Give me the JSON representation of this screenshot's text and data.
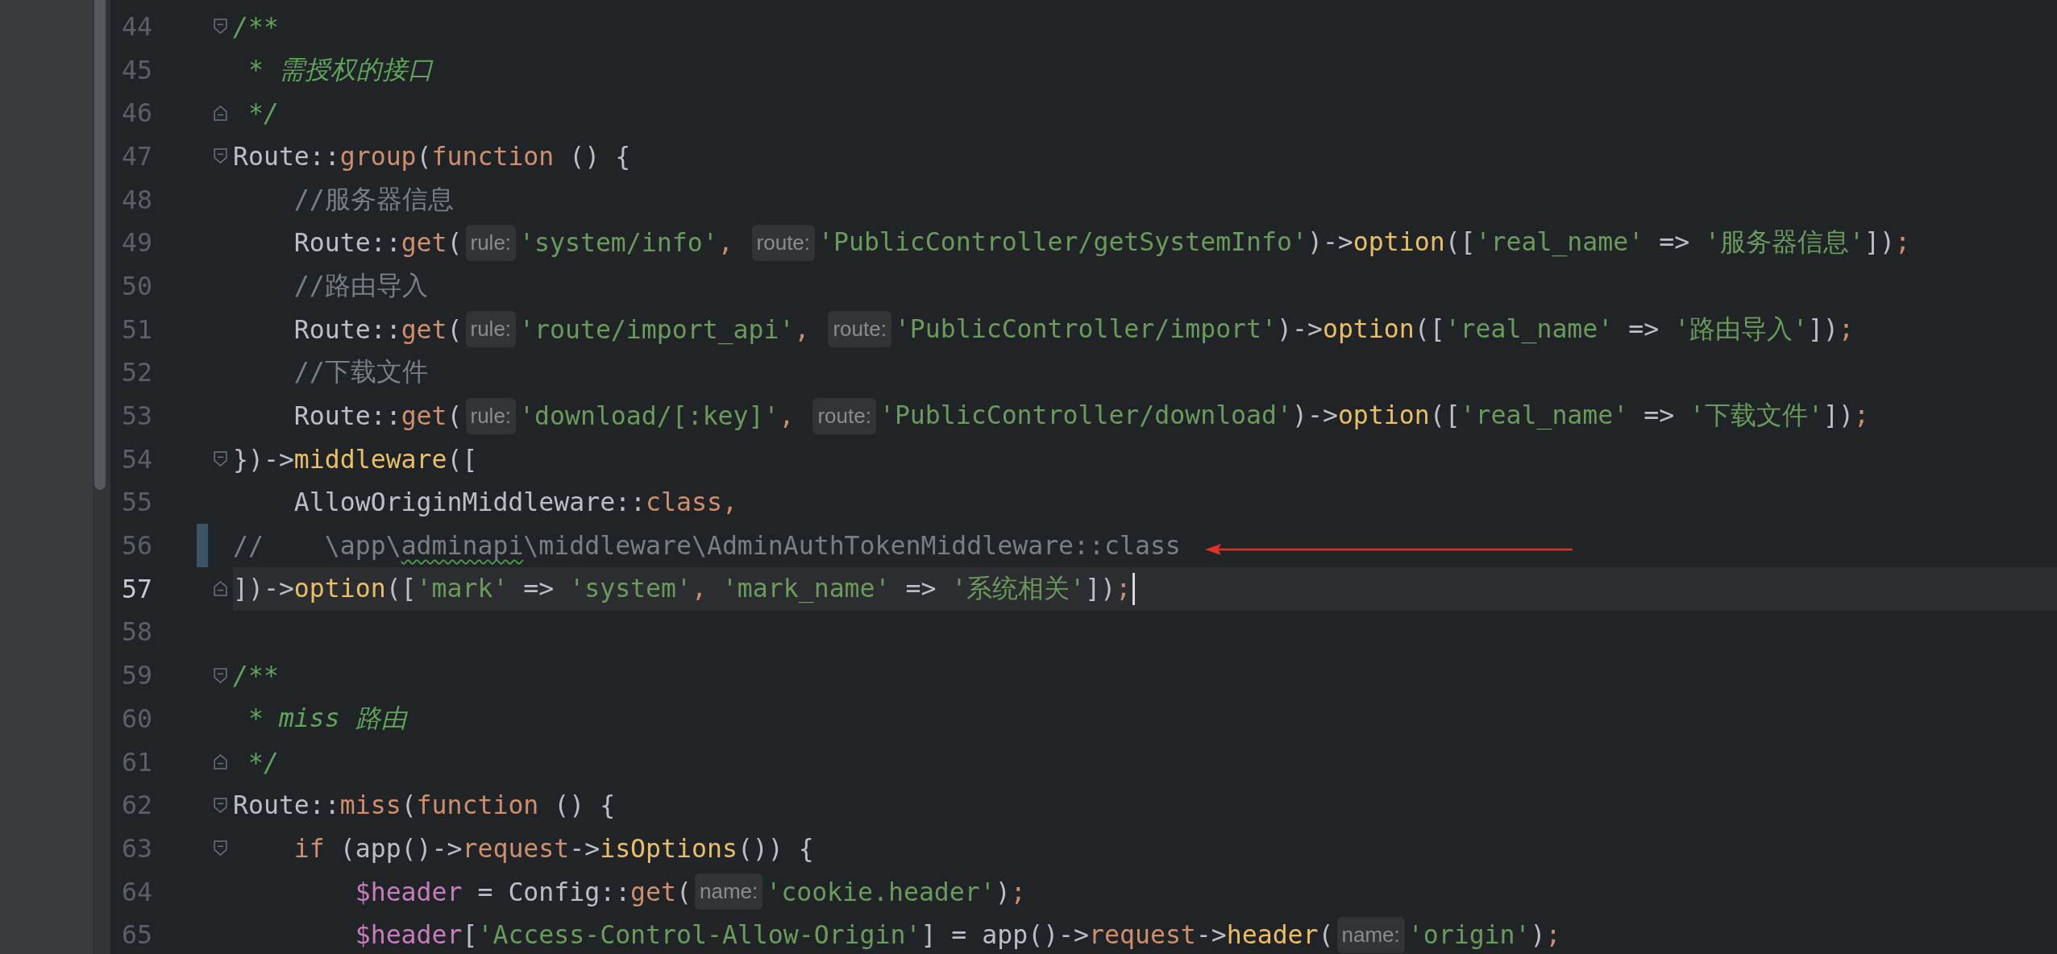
{
  "lines": [
    {
      "number": "44",
      "fold_open": true,
      "current": false,
      "changed": false,
      "tokens": [
        {
          "kind": "doc",
          "text": "/**"
        }
      ]
    },
    {
      "number": "45",
      "current": false,
      "changed": false,
      "tokens": [
        {
          "kind": "doc",
          "text": " * 需授权的接口"
        }
      ]
    },
    {
      "number": "46",
      "fold_close": true,
      "current": false,
      "changed": false,
      "tokens": [
        {
          "kind": "doc",
          "text": " */"
        }
      ]
    },
    {
      "number": "47",
      "fold_open": true,
      "current": false,
      "changed": false,
      "tokens": [
        {
          "kind": "text",
          "text": "Route::"
        },
        {
          "kind": "kw",
          "text": "group"
        },
        {
          "kind": "text",
          "text": "("
        },
        {
          "kind": "kw",
          "text": "function"
        },
        {
          "kind": "text",
          "text": " () {"
        }
      ]
    },
    {
      "number": "48",
      "current": false,
      "changed": false,
      "tokens": [
        {
          "kind": "comment",
          "text": "    //服务器信息"
        }
      ]
    },
    {
      "number": "49",
      "current": false,
      "changed": false,
      "tokens": [
        {
          "kind": "text",
          "text": "    Route::"
        },
        {
          "kind": "kw",
          "text": "get"
        },
        {
          "kind": "text",
          "text": "("
        },
        {
          "kind": "hint",
          "text": "rule:"
        },
        {
          "kind": "str",
          "text": "'system/info'"
        },
        {
          "kind": "kw",
          "text": ", "
        },
        {
          "kind": "hint",
          "text": "route:"
        },
        {
          "kind": "str",
          "text": "'PublicController/getSystemInfo'"
        },
        {
          "kind": "text",
          "text": ")->"
        },
        {
          "kind": "method",
          "text": "option"
        },
        {
          "kind": "text",
          "text": "(["
        },
        {
          "kind": "str",
          "text": "'real_name'"
        },
        {
          "kind": "text",
          "text": " => "
        },
        {
          "kind": "str",
          "text": "'服务器信息'"
        },
        {
          "kind": "text",
          "text": "])"
        },
        {
          "kind": "kw",
          "text": ";"
        }
      ]
    },
    {
      "number": "50",
      "current": false,
      "changed": false,
      "tokens": [
        {
          "kind": "comment",
          "text": "    //路由导入"
        }
      ]
    },
    {
      "number": "51",
      "current": false,
      "changed": false,
      "tokens": [
        {
          "kind": "text",
          "text": "    Route::"
        },
        {
          "kind": "kw",
          "text": "get"
        },
        {
          "kind": "text",
          "text": "("
        },
        {
          "kind": "hint",
          "text": "rule:"
        },
        {
          "kind": "str",
          "text": "'route/import_api'"
        },
        {
          "kind": "kw",
          "text": ", "
        },
        {
          "kind": "hint",
          "text": "route:"
        },
        {
          "kind": "str",
          "text": "'PublicController/import'"
        },
        {
          "kind": "text",
          "text": ")->"
        },
        {
          "kind": "method",
          "text": "option"
        },
        {
          "kind": "text",
          "text": "(["
        },
        {
          "kind": "str",
          "text": "'real_name'"
        },
        {
          "kind": "text",
          "text": " => "
        },
        {
          "kind": "str",
          "text": "'路由导入'"
        },
        {
          "kind": "text",
          "text": "])"
        },
        {
          "kind": "kw",
          "text": ";"
        }
      ]
    },
    {
      "number": "52",
      "current": false,
      "changed": false,
      "tokens": [
        {
          "kind": "comment",
          "text": "    //下载文件"
        }
      ]
    },
    {
      "number": "53",
      "current": false,
      "changed": false,
      "tokens": [
        {
          "kind": "text",
          "text": "    Route::"
        },
        {
          "kind": "kw",
          "text": "get"
        },
        {
          "kind": "text",
          "text": "("
        },
        {
          "kind": "hint",
          "text": "rule:"
        },
        {
          "kind": "str",
          "text": "'download/[:key]'"
        },
        {
          "kind": "kw",
          "text": ", "
        },
        {
          "kind": "hint",
          "text": "route:"
        },
        {
          "kind": "str",
          "text": "'PublicController/download'"
        },
        {
          "kind": "text",
          "text": ")->"
        },
        {
          "kind": "method",
          "text": "option"
        },
        {
          "kind": "text",
          "text": "(["
        },
        {
          "kind": "str",
          "text": "'real_name'"
        },
        {
          "kind": "text",
          "text": " => "
        },
        {
          "kind": "str",
          "text": "'下载文件'"
        },
        {
          "kind": "text",
          "text": "])"
        },
        {
          "kind": "kw",
          "text": ";"
        }
      ]
    },
    {
      "number": "54",
      "fold_open": true,
      "current": false,
      "changed": false,
      "tokens": [
        {
          "kind": "text",
          "text": "})->"
        },
        {
          "kind": "method",
          "text": "middleware"
        },
        {
          "kind": "text",
          "text": "(["
        }
      ]
    },
    {
      "number": "55",
      "current": false,
      "changed": false,
      "tokens": [
        {
          "kind": "text",
          "text": "    AllowOriginMiddleware::"
        },
        {
          "kind": "kw",
          "text": "class"
        },
        {
          "kind": "kw",
          "text": ","
        }
      ]
    },
    {
      "number": "56",
      "current": false,
      "changed": true,
      "arrow": true,
      "tokens": [
        {
          "kind": "comment",
          "text": "//    \\app\\"
        },
        {
          "kind": "typo",
          "text": "adminapi"
        },
        {
          "kind": "comment",
          "text": "\\middleware\\AdminAuthTokenMiddleware::class"
        }
      ]
    },
    {
      "number": "57",
      "fold_close": true,
      "current": true,
      "changed": false,
      "caret": true,
      "tokens": [
        {
          "kind": "text",
          "text": "])->"
        },
        {
          "kind": "method",
          "text": "option"
        },
        {
          "kind": "text",
          "text": "(["
        },
        {
          "kind": "str",
          "text": "'mark'"
        },
        {
          "kind": "text",
          "text": " => "
        },
        {
          "kind": "str",
          "text": "'system'"
        },
        {
          "kind": "kw",
          "text": ", "
        },
        {
          "kind": "str",
          "text": "'mark_name'"
        },
        {
          "kind": "text",
          "text": " => "
        },
        {
          "kind": "str",
          "text": "'系统相关'"
        },
        {
          "kind": "text",
          "text": "])"
        },
        {
          "kind": "kw",
          "text": ";"
        }
      ]
    },
    {
      "number": "58",
      "current": false,
      "changed": false
    },
    {
      "number": "59",
      "fold_open": true,
      "current": false,
      "changed": false,
      "tokens": [
        {
          "kind": "doc",
          "text": "/**"
        }
      ]
    },
    {
      "number": "60",
      "current": false,
      "changed": false,
      "tokens": [
        {
          "kind": "doc",
          "text": " * miss 路由"
        }
      ]
    },
    {
      "number": "61",
      "fold_close": true,
      "current": false,
      "changed": false,
      "tokens": [
        {
          "kind": "doc",
          "text": " */"
        }
      ]
    },
    {
      "number": "62",
      "fold_open": true,
      "current": false,
      "changed": false,
      "tokens": [
        {
          "kind": "text",
          "text": "Route::"
        },
        {
          "kind": "kw",
          "text": "miss"
        },
        {
          "kind": "text",
          "text": "("
        },
        {
          "kind": "kw",
          "text": "function"
        },
        {
          "kind": "text",
          "text": " () {"
        }
      ]
    },
    {
      "number": "63",
      "fold_open": true,
      "current": false,
      "changed": false,
      "tokens": [
        {
          "kind": "kw",
          "text": "    if"
        },
        {
          "kind": "text",
          "text": " (app()->"
        },
        {
          "kind": "kw",
          "text": "request"
        },
        {
          "kind": "text",
          "text": "->"
        },
        {
          "kind": "method",
          "text": "isOptions"
        },
        {
          "kind": "text",
          "text": "()) {"
        }
      ]
    },
    {
      "number": "64",
      "current": false,
      "changed": false,
      "tokens": [
        {
          "kind": "var",
          "text": "        $header"
        },
        {
          "kind": "text",
          "text": " = Config::"
        },
        {
          "kind": "kw",
          "text": "get"
        },
        {
          "kind": "text",
          "text": "("
        },
        {
          "kind": "hint",
          "text": "name:"
        },
        {
          "kind": "str",
          "text": "'cookie.header'"
        },
        {
          "kind": "text",
          "text": ")"
        },
        {
          "kind": "kw",
          "text": ";"
        }
      ]
    },
    {
      "number": "65",
      "current": false,
      "changed": false,
      "tokens": [
        {
          "kind": "var",
          "text": "        $header"
        },
        {
          "kind": "text",
          "text": "["
        },
        {
          "kind": "str",
          "text": "'Access-Control-Allow-Origin'"
        },
        {
          "kind": "text",
          "text": "] = app()->"
        },
        {
          "kind": "kw",
          "text": "request"
        },
        {
          "kind": "text",
          "text": "->"
        },
        {
          "kind": "method",
          "text": "header"
        },
        {
          "kind": "text",
          "text": "("
        },
        {
          "kind": "hint",
          "text": "name:"
        },
        {
          "kind": "str",
          "text": "'origin'"
        },
        {
          "kind": "text",
          "text": ")"
        },
        {
          "kind": "kw",
          "text": ";"
        }
      ]
    }
  ]
}
